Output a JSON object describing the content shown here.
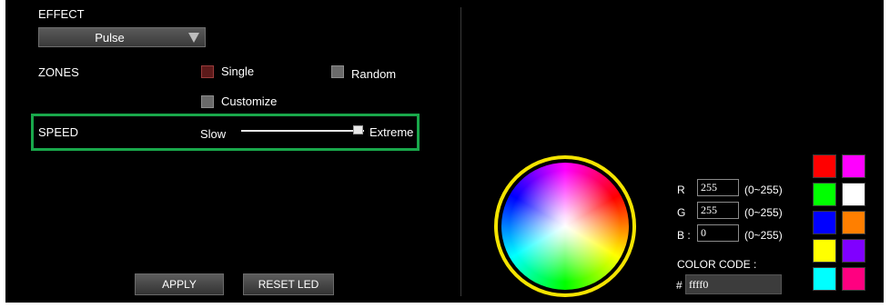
{
  "effect": {
    "label": "EFFECT",
    "value": "Pulse"
  },
  "zones": {
    "label": "ZONES",
    "options": [
      {
        "label": "Single",
        "checked": true
      },
      {
        "label": "Random",
        "checked": false
      },
      {
        "label": "Customize",
        "checked": false
      }
    ]
  },
  "speed": {
    "label": "SPEED",
    "min_label": "Slow",
    "max_label": "Extreme",
    "level": 0.93
  },
  "buttons": {
    "apply": "APPLY",
    "reset": "RESET LED"
  },
  "color": {
    "r_label": "R",
    "g_label": "G",
    "b_label": "B :",
    "r": "255",
    "g": "255",
    "b": "0",
    "range": "(0~255)",
    "code_label": "COLOR CODE :",
    "hash": "#",
    "code": "ffff0"
  },
  "swatches": [
    "#ff0000",
    "#ff00ff",
    "#00ff00",
    "#ffffff",
    "#0000ff",
    "#ff7f00",
    "#ffff00",
    "#8000ff",
    "#00ffff",
    "#ff0080"
  ],
  "colors": {
    "highlight": "#19a84b",
    "wheel_ring": "#f4e400",
    "checked": "#5c1a1a"
  }
}
